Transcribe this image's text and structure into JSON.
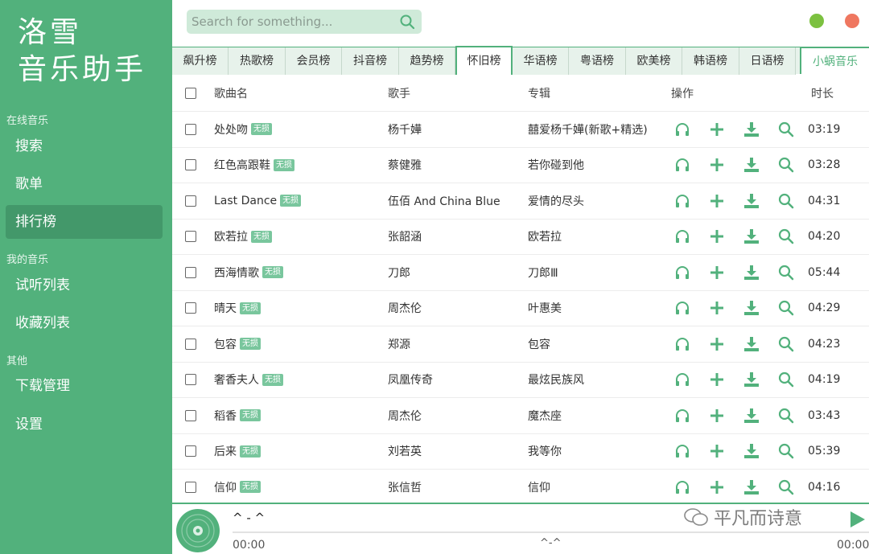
{
  "app": {
    "logo_line1": "洛雪",
    "logo_line2": "音乐助手"
  },
  "sidebar": {
    "section_online": "在线音乐",
    "section_mine": "我的音乐",
    "section_other": "其他",
    "items": [
      {
        "label": "搜索"
      },
      {
        "label": "歌单"
      },
      {
        "label": "排行榜"
      },
      {
        "label": "试听列表"
      },
      {
        "label": "收藏列表"
      },
      {
        "label": "下载管理"
      },
      {
        "label": "设置"
      }
    ],
    "active": "排行榜"
  },
  "search": {
    "placeholder": "Search for something..."
  },
  "tabs": [
    {
      "label": "飙升榜"
    },
    {
      "label": "热歌榜"
    },
    {
      "label": "会员榜"
    },
    {
      "label": "抖音榜"
    },
    {
      "label": "趋势榜"
    },
    {
      "label": "怀旧榜"
    },
    {
      "label": "华语榜"
    },
    {
      "label": "粤语榜"
    },
    {
      "label": "欧美榜"
    },
    {
      "label": "韩语榜"
    },
    {
      "label": "日语榜"
    }
  ],
  "active_tab": "怀旧榜",
  "source_tab": "小蜗音乐",
  "table": {
    "headers": {
      "name": "歌曲名",
      "artist": "歌手",
      "album": "专辑",
      "ops": "操作",
      "duration": "时长"
    },
    "badge": "无损",
    "rows": [
      {
        "name": "处处吻",
        "artist": "杨千嬅",
        "album": "囍爱杨千嬅(新歌+精选)",
        "duration": "03:19"
      },
      {
        "name": "红色高跟鞋",
        "artist": "蔡健雅",
        "album": "若你碰到他",
        "duration": "03:28"
      },
      {
        "name": "Last Dance",
        "artist": "伍佰 And China Blue",
        "album": "爱情的尽头",
        "duration": "04:31"
      },
      {
        "name": "欧若拉",
        "artist": "张韶涵",
        "album": "欧若拉",
        "duration": "04:20"
      },
      {
        "name": "西海情歌",
        "artist": "刀郎",
        "album": "刀郎Ⅲ",
        "duration": "05:44"
      },
      {
        "name": "晴天",
        "artist": "周杰伦",
        "album": "叶惠美",
        "duration": "04:29"
      },
      {
        "name": "包容",
        "artist": "郑源",
        "album": "包容",
        "duration": "04:23"
      },
      {
        "name": "奢香夫人",
        "artist": "凤凰传奇",
        "album": "最炫民族风",
        "duration": "04:19"
      },
      {
        "name": "稻香",
        "artist": "周杰伦",
        "album": "魔杰座",
        "duration": "03:43"
      },
      {
        "name": "后来",
        "artist": "刘若英",
        "album": "我等你",
        "duration": "05:39"
      },
      {
        "name": "信仰",
        "artist": "张信哲",
        "album": "信仰",
        "duration": "04:16"
      }
    ]
  },
  "player": {
    "title": "^ - ^",
    "current_time": "00:00",
    "middle_text": "^-^",
    "total_time": "00:00",
    "progress": 0
  },
  "watermark": "平凡而诗意",
  "colors": {
    "primary": "#52b17c",
    "sidebar_active": "#43986a",
    "badge": "#79c69d",
    "window_green": "#7cc140",
    "window_red": "#ef7760"
  }
}
